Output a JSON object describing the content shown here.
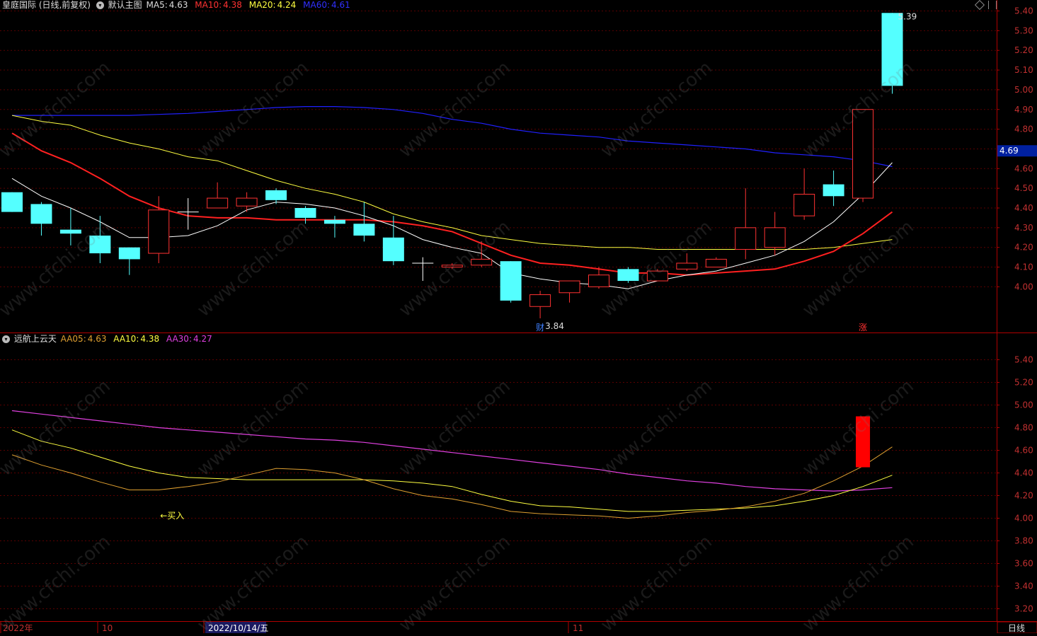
{
  "main_header": {
    "title": "皇庭国际 (日线,前复权)",
    "template": "默认主图",
    "ma5_label": "MA5:",
    "ma5_value": "4.63",
    "ma10_label": "MA10:",
    "ma10_value": "4.38",
    "ma20_label": "MA20:",
    "ma20_value": "4.24",
    "ma60_label": "MA60:",
    "ma60_value": "4.61"
  },
  "sub_header": {
    "title": "远航上云天",
    "aa05_label": "AA05:",
    "aa05_value": "4.63",
    "aa10_label": "AA10:",
    "aa10_value": "4.38",
    "aa30_label": "AA30:",
    "aa30_value": "4.27"
  },
  "price_axis_ticks": [
    "5.40",
    "5.30",
    "5.20",
    "5.10",
    "5.00",
    "4.90",
    "4.80",
    "4.70",
    "4.60",
    "4.50",
    "4.40",
    "4.30",
    "4.20",
    "4.10",
    "4.00"
  ],
  "current_price_tag": "4.69",
  "sub_axis_ticks": [
    "5.40",
    "5.20",
    "5.00",
    "4.80",
    "4.60",
    "4.40",
    "4.20",
    "4.00",
    "3.80",
    "3.60",
    "3.40",
    "3.20"
  ],
  "annotations": {
    "high_label": "5.39",
    "low_label": "←3.84",
    "cai_badge": "财",
    "zhang_badge": "涨",
    "buy_label": "←买入"
  },
  "date_axis": {
    "labels": [
      "2022年",
      "10",
      "2022/10/14/五",
      "11"
    ],
    "period_label": "日线"
  },
  "watermark": "www.cfchi.com",
  "colors": {
    "up": "#ff3232",
    "down": "#54ffff",
    "ma5": "#ffffff",
    "ma10": "#ff2020",
    "ma20": "#ffff40",
    "ma60": "#2020ff",
    "aa05": "#e0a030",
    "aa10": "#ffff40",
    "aa30": "#e040e0",
    "grid": "#5a0000",
    "axis_text": "#c03030"
  },
  "chart_data": {
    "type": "candlestick",
    "candles": [
      {
        "o": 4.48,
        "h": 4.48,
        "l": 4.38,
        "c": 4.38
      },
      {
        "o": 4.42,
        "h": 4.43,
        "l": 4.26,
        "c": 4.32
      },
      {
        "o": 4.29,
        "h": 4.4,
        "l": 4.21,
        "c": 4.27
      },
      {
        "o": 4.26,
        "h": 4.36,
        "l": 4.12,
        "c": 4.17
      },
      {
        "o": 4.2,
        "h": 4.2,
        "l": 4.06,
        "c": 4.14
      },
      {
        "o": 4.17,
        "h": 4.46,
        "l": 4.12,
        "c": 4.39
      },
      {
        "o": 4.38,
        "h": 4.45,
        "l": 4.29,
        "c": 4.38
      },
      {
        "o": 4.4,
        "h": 4.53,
        "l": 4.4,
        "c": 4.45
      },
      {
        "o": 4.41,
        "h": 4.48,
        "l": 4.38,
        "c": 4.45
      },
      {
        "o": 4.49,
        "h": 4.5,
        "l": 4.42,
        "c": 4.44
      },
      {
        "o": 4.4,
        "h": 4.41,
        "l": 4.32,
        "c": 4.35
      },
      {
        "o": 4.34,
        "h": 4.36,
        "l": 4.25,
        "c": 4.32
      },
      {
        "o": 4.32,
        "h": 4.43,
        "l": 4.23,
        "c": 4.26
      },
      {
        "o": 4.25,
        "h": 4.36,
        "l": 4.11,
        "c": 4.13
      },
      {
        "o": 4.12,
        "h": 4.15,
        "l": 4.03,
        "c": 4.12
      },
      {
        "o": 4.1,
        "h": 4.12,
        "l": 4.09,
        "c": 4.11
      },
      {
        "o": 4.11,
        "h": 4.23,
        "l": 4.1,
        "c": 4.14
      },
      {
        "o": 4.13,
        "h": 4.13,
        "l": 3.92,
        "c": 3.93
      },
      {
        "o": 3.9,
        "h": 3.98,
        "l": 3.84,
        "c": 3.96
      },
      {
        "o": 3.97,
        "h": 4.03,
        "l": 3.92,
        "c": 4.03
      },
      {
        "o": 4.0,
        "h": 4.1,
        "l": 3.99,
        "c": 4.06
      },
      {
        "o": 4.09,
        "h": 4.1,
        "l": 4.02,
        "c": 4.03
      },
      {
        "o": 4.03,
        "h": 4.09,
        "l": 4.03,
        "c": 4.08
      },
      {
        "o": 4.09,
        "h": 4.17,
        "l": 4.08,
        "c": 4.12
      },
      {
        "o": 4.1,
        "h": 4.15,
        "l": 4.1,
        "c": 4.14
      },
      {
        "o": 4.19,
        "h": 4.5,
        "l": 4.14,
        "c": 4.3
      },
      {
        "o": 4.2,
        "h": 4.38,
        "l": 4.16,
        "c": 4.3
      },
      {
        "o": 4.36,
        "h": 4.6,
        "l": 4.34,
        "c": 4.47
      },
      {
        "o": 4.52,
        "h": 4.59,
        "l": 4.41,
        "c": 4.46
      },
      {
        "o": 4.45,
        "h": 4.9,
        "l": 4.43,
        "c": 4.9
      },
      {
        "o": 5.39,
        "h": 5.39,
        "l": 4.98,
        "c": 5.02
      }
    ],
    "ma5": [
      4.55,
      4.46,
      4.4,
      4.33,
      4.25,
      4.25,
      4.26,
      4.31,
      4.39,
      4.43,
      4.42,
      4.4,
      4.36,
      4.31,
      4.24,
      4.2,
      4.17,
      4.07,
      4.04,
      4.02,
      4.01,
      3.99,
      4.03,
      4.06,
      4.08,
      4.12,
      4.16,
      4.23,
      4.33,
      4.47,
      4.63
    ],
    "ma10": [
      4.78,
      4.69,
      4.63,
      4.55,
      4.46,
      4.4,
      4.36,
      4.35,
      4.35,
      4.34,
      4.34,
      4.34,
      4.34,
      4.33,
      4.31,
      4.28,
      4.22,
      4.16,
      4.12,
      4.11,
      4.09,
      4.07,
      4.07,
      4.06,
      4.07,
      4.08,
      4.09,
      4.13,
      4.18,
      4.27,
      4.38
    ],
    "ma20": [
      4.87,
      4.84,
      4.82,
      4.77,
      4.73,
      4.7,
      4.66,
      4.64,
      4.59,
      4.54,
      4.5,
      4.47,
      4.43,
      4.37,
      4.33,
      4.3,
      4.26,
      4.24,
      4.22,
      4.21,
      4.2,
      4.2,
      4.19,
      4.19,
      4.19,
      4.19,
      4.19,
      4.19,
      4.2,
      4.22,
      4.24
    ],
    "ma60": [
      4.87,
      4.87,
      4.87,
      4.87,
      4.87,
      4.875,
      4.88,
      4.89,
      4.9,
      4.91,
      4.915,
      4.915,
      4.91,
      4.9,
      4.88,
      4.85,
      4.83,
      4.8,
      4.78,
      4.77,
      4.76,
      4.74,
      4.73,
      4.72,
      4.71,
      4.7,
      4.68,
      4.67,
      4.66,
      4.64,
      4.61
    ],
    "aa05": [
      4.56,
      4.47,
      4.4,
      4.32,
      4.25,
      4.25,
      4.28,
      4.32,
      4.38,
      4.44,
      4.43,
      4.4,
      4.34,
      4.26,
      4.2,
      4.17,
      4.12,
      4.06,
      4.04,
      4.03,
      4.02,
      4.0,
      4.02,
      4.05,
      4.07,
      4.1,
      4.15,
      4.22,
      4.33,
      4.46,
      4.63
    ],
    "aa10": [
      4.78,
      4.68,
      4.62,
      4.54,
      4.46,
      4.4,
      4.36,
      4.35,
      4.34,
      4.34,
      4.34,
      4.34,
      4.34,
      4.33,
      4.31,
      4.28,
      4.21,
      4.15,
      4.11,
      4.1,
      4.08,
      4.06,
      4.06,
      4.07,
      4.08,
      4.09,
      4.11,
      4.15,
      4.2,
      4.28,
      4.38
    ],
    "aa30": [
      4.95,
      4.92,
      4.89,
      4.86,
      4.83,
      4.8,
      4.78,
      4.76,
      4.74,
      4.72,
      4.7,
      4.69,
      4.67,
      4.64,
      4.61,
      4.58,
      4.55,
      4.52,
      4.49,
      4.46,
      4.43,
      4.39,
      4.36,
      4.33,
      4.31,
      4.28,
      4.26,
      4.25,
      4.24,
      4.25,
      4.27
    ],
    "signal_bar": {
      "index": 29,
      "from": 4.45,
      "to": 4.9
    },
    "buy_marker_index": 5,
    "main_ylim": [
      3.9,
      5.45
    ],
    "sub_ylim": [
      3.15,
      5.55
    ]
  }
}
